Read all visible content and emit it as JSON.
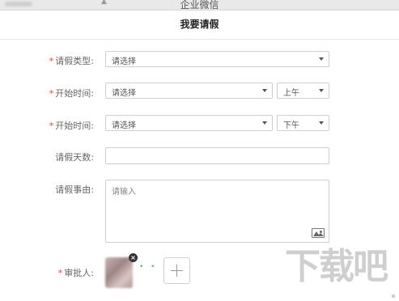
{
  "window": {
    "app_title": "企业微信"
  },
  "page": {
    "title": "我要请假"
  },
  "form": {
    "required_mark": "*",
    "leave_type": {
      "label": "请假类型:",
      "value": "请选择"
    },
    "start_time": {
      "label": "开始时间:",
      "date_value": "请选择",
      "period_value": "上午"
    },
    "end_time": {
      "label": "开始时间:",
      "date_value": "请选择",
      "period_value": "下午"
    },
    "days": {
      "label": "请假天数:",
      "value": ""
    },
    "reason": {
      "label": "请假事由:",
      "placeholder": "请输入"
    },
    "approver": {
      "label": "审批人:",
      "remove_glyph": "×",
      "connector": "• • •"
    }
  },
  "watermark": {
    "text": "下载吧"
  },
  "colors": {
    "required": "#e64340",
    "connector": "#55c166",
    "border": "#cfcfcf"
  }
}
